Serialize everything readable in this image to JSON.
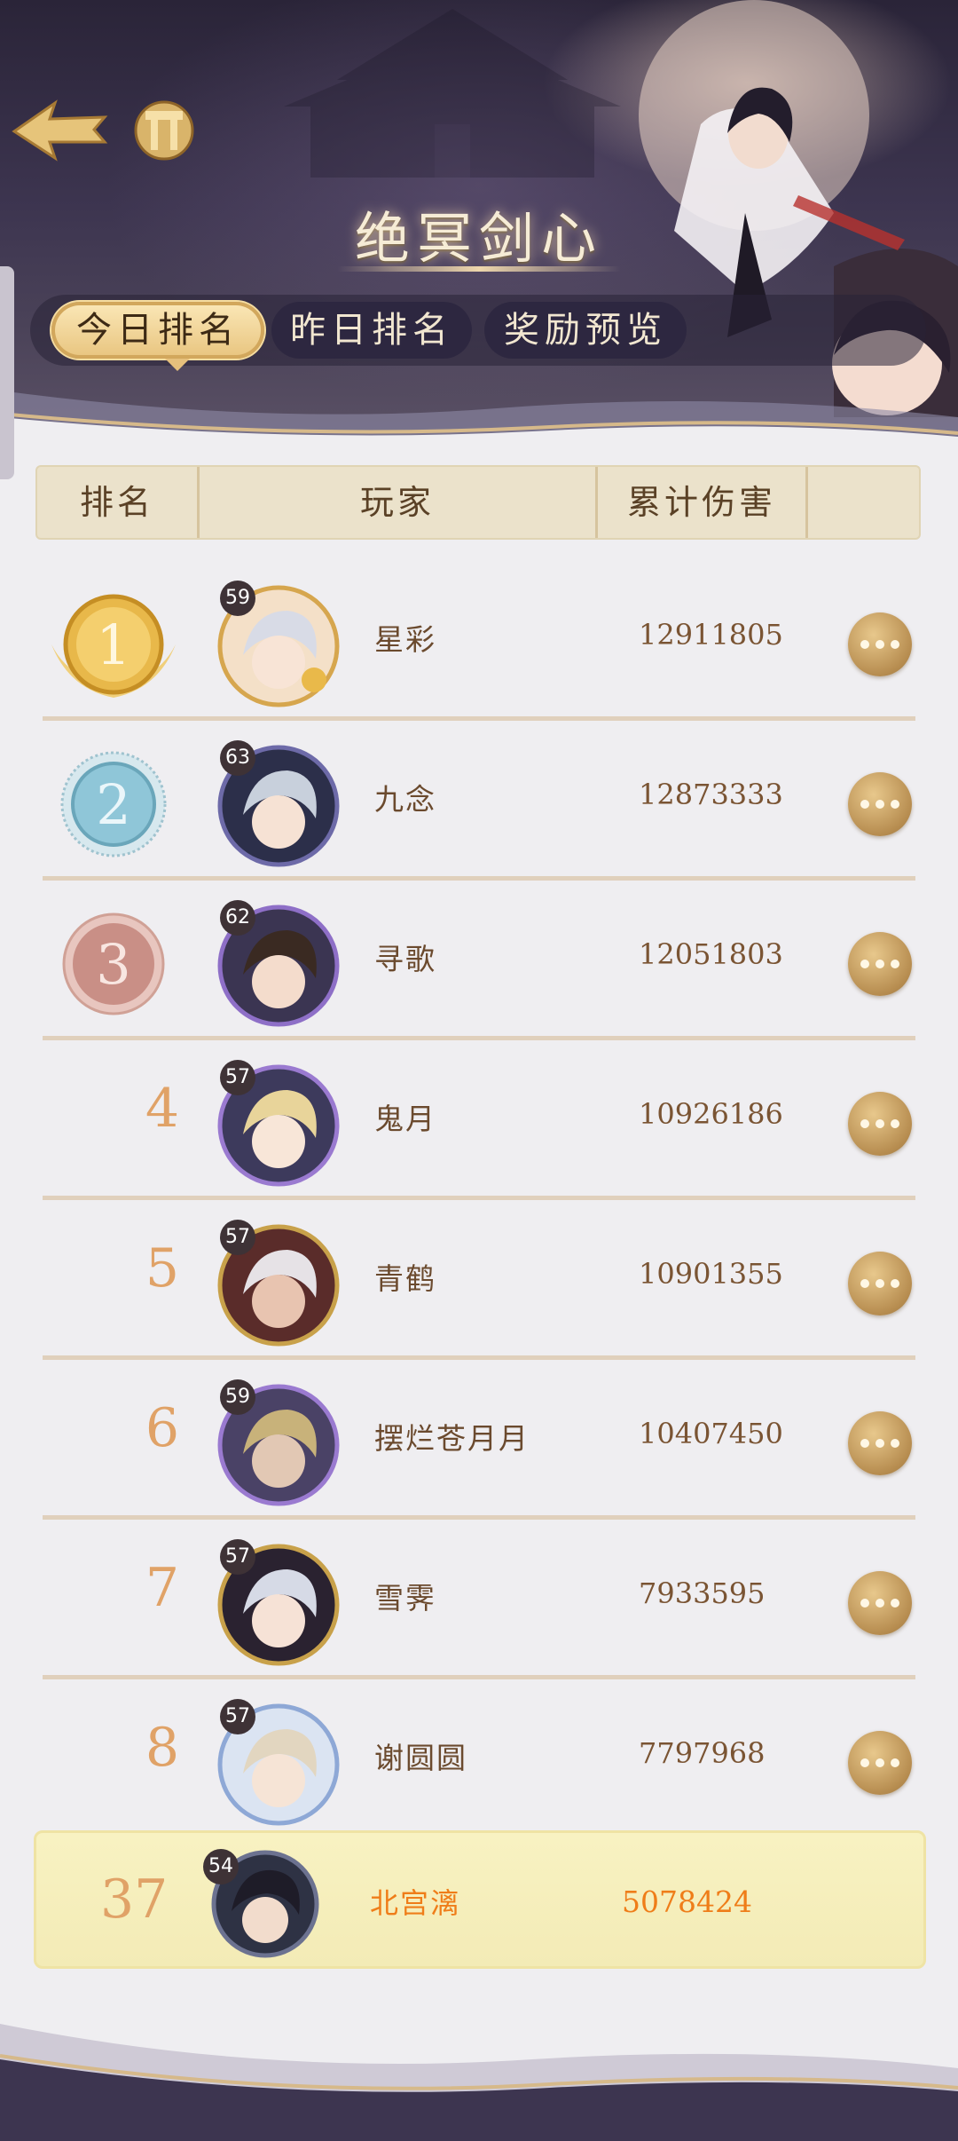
{
  "title": "绝冥剑心",
  "tabs": [
    {
      "label": "今日排名",
      "active": true
    },
    {
      "label": "昨日排名",
      "active": false
    },
    {
      "label": "奖励预览",
      "active": false
    }
  ],
  "table": {
    "headers": {
      "rank": "排名",
      "player": "玩家",
      "damage": "累计伤害",
      "action": ""
    }
  },
  "rows": [
    {
      "rank": "1",
      "medal": "gold",
      "level": "59",
      "name": "星彩",
      "damage": "12911805"
    },
    {
      "rank": "2",
      "medal": "silver",
      "level": "63",
      "name": "九念",
      "damage": "12873333"
    },
    {
      "rank": "3",
      "medal": "bronze",
      "level": "62",
      "name": "寻歌",
      "damage": "12051803"
    },
    {
      "rank": "4",
      "medal": "",
      "level": "57",
      "name": "鬼月",
      "damage": "10926186"
    },
    {
      "rank": "5",
      "medal": "",
      "level": "57",
      "name": "青鹤",
      "damage": "10901355"
    },
    {
      "rank": "6",
      "medal": "",
      "level": "59",
      "name": "摆烂苍月月",
      "damage": "10407450"
    },
    {
      "rank": "7",
      "medal": "",
      "level": "57",
      "name": "雪霁",
      "damage": "7933595"
    },
    {
      "rank": "8",
      "medal": "",
      "level": "57",
      "name": "谢圆圆",
      "damage": "7797968"
    }
  ],
  "my_rank": {
    "rank": "37",
    "level": "54",
    "name": "北宫漓",
    "damage": "5078424"
  },
  "colors": {
    "rank_text": "#e0a267",
    "name_text": "#6b4a2e",
    "self_highlight": "#ef7d19",
    "gold": "#e8b84a",
    "silver": "#8fc6d8",
    "bronze": "#c98f86"
  },
  "icons": {
    "back": "back-arrow-icon",
    "rank_badge": "ranking-pillar-icon",
    "more": "more-dots-icon"
  }
}
